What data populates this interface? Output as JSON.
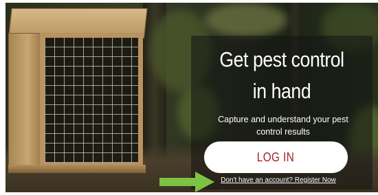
{
  "hero": {
    "headline": "Get pest control in hand",
    "subtitle": "Capture and understand your pest control results"
  },
  "actions": {
    "login_label": "LOG IN",
    "register_label": "Don't have an account? Register Now"
  },
  "colors": {
    "login_text": "#a31d2d",
    "login_background": "#ffffff",
    "arrow": "#7dc242",
    "panel_overlay": "rgba(20,20,18,0.55)"
  },
  "icons": {
    "annotation_arrow": "right-arrow-icon"
  }
}
